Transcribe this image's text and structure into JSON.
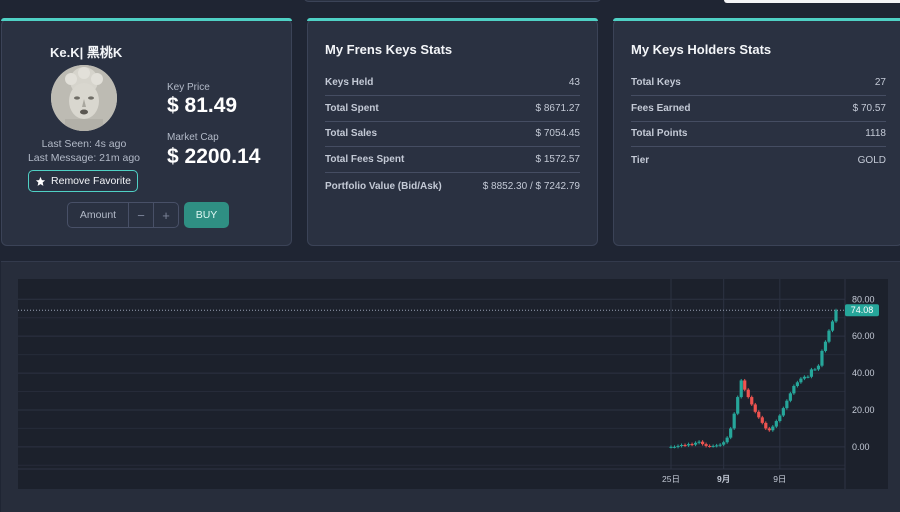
{
  "profile": {
    "name": "Ke.K| 黑桃K",
    "last_seen": "Last Seen: 4s ago",
    "last_message": "Last Message: 21m ago",
    "favorite_label": "Remove Favorite",
    "key_price_label": "Key Price",
    "key_price": "$ 81.49",
    "market_cap_label": "Market Cap",
    "market_cap": "$ 2200.14",
    "amount_placeholder": "Amount",
    "minus": "−",
    "plus": "+",
    "buy_label": "BUY"
  },
  "frens_stats": {
    "title": "My Frens Keys Stats",
    "rows": [
      {
        "label": "Keys Held",
        "value": "43"
      },
      {
        "label": "Total Spent",
        "value": "$ 8671.27"
      },
      {
        "label": "Total Sales",
        "value": "$ 7054.45"
      },
      {
        "label": "Total Fees Spent",
        "value": "$ 1572.57"
      },
      {
        "label": "Portfolio Value (Bid/Ask)",
        "value": "$ 8852.30 / $ 7242.79"
      }
    ]
  },
  "holders_stats": {
    "title": "My Keys Holders Stats",
    "rows": [
      {
        "label": "Total Keys",
        "value": "27"
      },
      {
        "label": "Fees Earned",
        "value": "$ 70.57"
      },
      {
        "label": "Total Points",
        "value": "1118"
      },
      {
        "label": "Tier",
        "value": "GOLD"
      }
    ]
  },
  "colors": {
    "accent": "#4fd1c5",
    "up": "#26a69a",
    "down": "#ef5350",
    "price_tag": "#26a69a"
  },
  "chart_data": {
    "type": "candlestick",
    "y_ticks": [
      "80.00",
      "60.00",
      "40.00",
      "20.00",
      "0.00"
    ],
    "x_ticks": [
      "25日",
      "9月",
      "9日"
    ],
    "last_price_label": "74.08",
    "last_price": 74.08,
    "ylim": [
      -12,
      91
    ],
    "closes": [
      0,
      0,
      0.5,
      1,
      0.8,
      1.5,
      1.2,
      2.2,
      2.8,
      1.5,
      0.5,
      0.4,
      0.5,
      0.8,
      1.2,
      2.5,
      5,
      10,
      18,
      27,
      36,
      31,
      27,
      23,
      19,
      16,
      13,
      10,
      9,
      11,
      14,
      17,
      21,
      25,
      29,
      33,
      35,
      37,
      38,
      38,
      42,
      42,
      44,
      52,
      57,
      63,
      68,
      74.08
    ]
  }
}
